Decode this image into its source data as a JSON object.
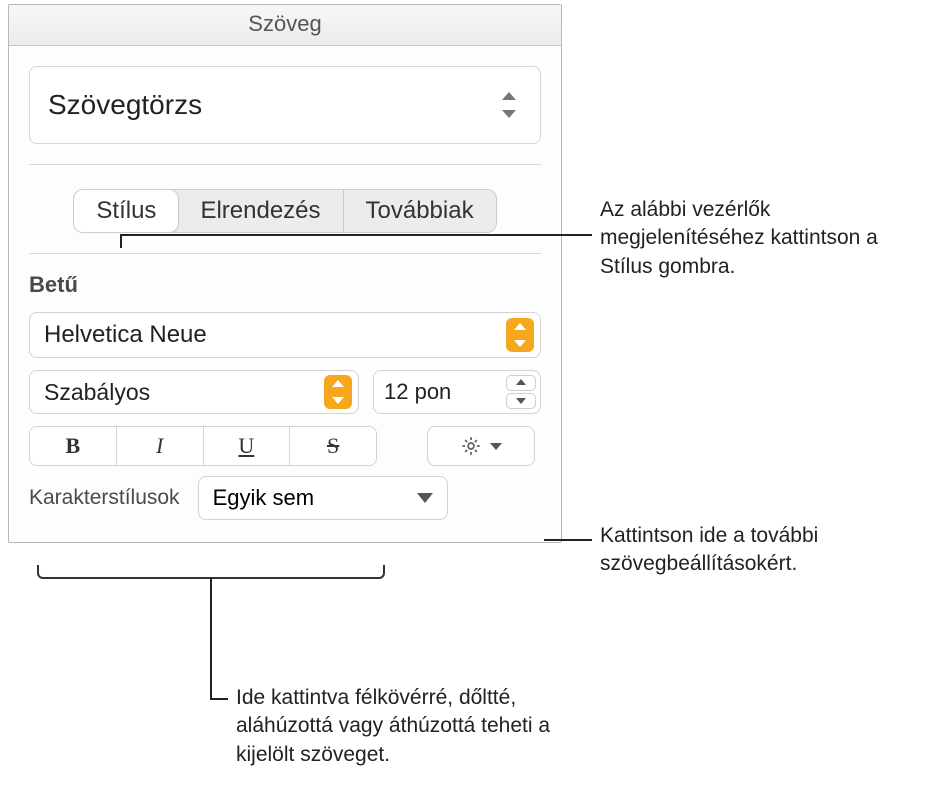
{
  "header": {
    "title": "Szöveg"
  },
  "paragraph_style": {
    "value": "Szövegtörzs"
  },
  "tabs": {
    "items": [
      {
        "label": "Stílus",
        "active": true
      },
      {
        "label": "Elrendezés",
        "active": false
      },
      {
        "label": "Továbbiak",
        "active": false
      }
    ]
  },
  "font_section": {
    "label": "Betű",
    "font_family": "Helvetica Neue",
    "font_variant": "Szabályos",
    "font_size": "12 pon",
    "bius": {
      "b": "B",
      "i": "I",
      "u": "U",
      "s": "S"
    },
    "char_styles_label": "Karakterstílusok",
    "char_styles_value": "Egyik sem"
  },
  "callouts": {
    "style_tab": "Az alábbi vezérlők megjelenítéséhez kattintson a Stílus gombra.",
    "more_options": "Kattintson ide a további szövegbeállításokért.",
    "bius": "Ide kattintva félkövérré, dőltté, aláhúzottá vagy áthúzottá teheti a kijelölt szöveget."
  }
}
